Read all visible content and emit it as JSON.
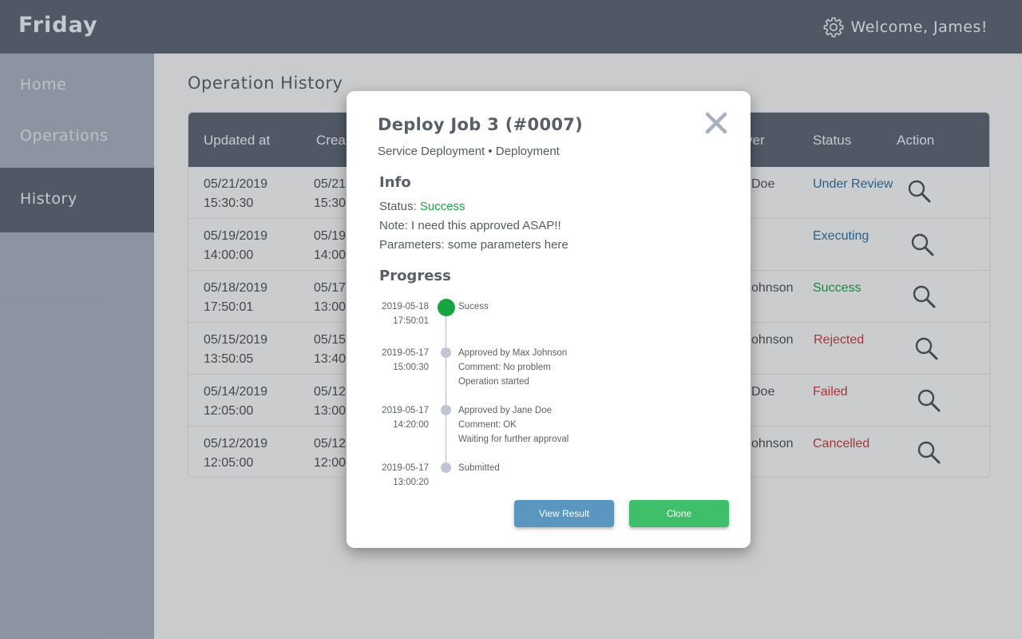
{
  "app": {
    "brand": "Friday",
    "welcome": "Welcome, James!"
  },
  "nav": {
    "home": "Home",
    "operations": "Operations",
    "history": "History"
  },
  "page": {
    "title": "Operation History"
  },
  "table": {
    "headers": {
      "updated": "Updated at",
      "created": "Crea",
      "approver": "ver",
      "status": "Status",
      "action": "Action"
    },
    "rows": [
      {
        "updated": "05/21/2019\n15:30:30",
        "created": "05/21\n15:30",
        "approver": "Doe",
        "status": "Under Review",
        "status_color": "#2d6a9a"
      },
      {
        "updated": "05/19/2019\n14:00:00",
        "created": "05/19\n14:00",
        "approver": "",
        "status": "Executing",
        "status_color": "#2d6a9a"
      },
      {
        "updated": "05/18/2019\n17:50:01",
        "created": "05/17\n13:00",
        "approver": "ohnson",
        "status": "Success",
        "status_color": "#1a9a3e"
      },
      {
        "updated": "05/15/2019\n13:50:05",
        "created": "05/15\n13:40",
        "approver": "ohnson",
        "status": "Rejected",
        "status_color": "#c0393b"
      },
      {
        "updated": "05/14/2019\n12:05:00",
        "created": "05/12\n13:00",
        "approver": "Doe",
        "status": "Failed",
        "status_color": "#c0393b"
      },
      {
        "updated": "05/12/2019\n12:05:00",
        "created": "05/12\n12:00",
        "approver": "ohnson",
        "status": "Cancelled",
        "status_color": "#c0393b"
      }
    ]
  },
  "modal": {
    "title": "Deploy Job 3 (#0007)",
    "subtitle": "Service Deployment • Deployment",
    "info_heading": "Info",
    "status_label": "Status: ",
    "status_value": "Success",
    "note": "Note: I need this approved ASAP!!",
    "parameters": "Parameters: some parameters here",
    "progress_heading": "Progress",
    "timeline": [
      {
        "time": "2019-05-18\n17:50:01",
        "text": "Sucess",
        "current": true
      },
      {
        "time": "2019-05-17\n15:00:30",
        "text": "Approved by Max Johnson\nComment: No problem\nOperation started",
        "current": false
      },
      {
        "time": "2019-05-17\n14:20:00",
        "text": "Approved by Jane Doe\nComment: OK\nWaiting for further approval",
        "current": false
      },
      {
        "time": "2019-05-17\n13:00:20",
        "text": "Submitted",
        "current": false
      }
    ],
    "view_result": "View Result",
    "clone": "Clone"
  },
  "colors": {
    "success": "#18a441",
    "header": "#5a6272",
    "sidebar": "#a4abba"
  },
  "icons": {
    "settings": "gear-icon",
    "close": "close-icon",
    "view": "search-icon"
  }
}
